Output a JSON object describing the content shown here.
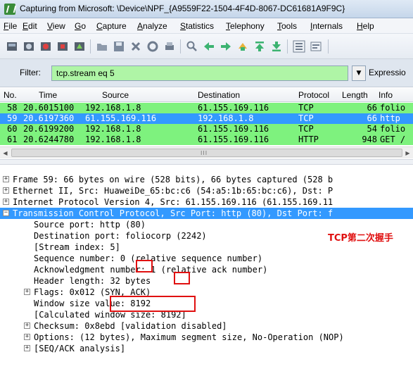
{
  "window": {
    "title": "Capturing from Microsoft: \\Device\\NPF_{A9559F22-1504-4F4D-8067-DC61681A9F9C}"
  },
  "menu": [
    "File",
    "Edit",
    "View",
    "Go",
    "Capture",
    "Analyze",
    "Statistics",
    "Telephony",
    "Tools",
    "Internals",
    "Help"
  ],
  "toolbar_icons": [
    "start-capture-icon",
    "stop-capture-icon",
    "restart-capture-icon",
    "capture-options-icon",
    "interfaces-icon",
    "open-file-icon",
    "save-file-icon",
    "close-file-icon",
    "reload-icon",
    "print-icon",
    "find-icon",
    "back-icon",
    "forward-icon",
    "goto-icon",
    "goto-first-icon",
    "goto-last-icon",
    "colorize-icon",
    "autoscroll-icon"
  ],
  "filter": {
    "label": "Filter:",
    "value": "tcp.stream eq 5",
    "expression_label": "Expressio"
  },
  "packet_list": {
    "columns": [
      "No.",
      "Time",
      "Source",
      "Destination",
      "Protocol",
      "Length",
      "Info"
    ],
    "rows": [
      {
        "no": "58",
        "time": "20.6015100",
        "source": "192.168.1.8",
        "destination": "61.155.169.116",
        "protocol": "TCP",
        "length": "66",
        "info": "folio"
      },
      {
        "no": "59",
        "time": "20.6197360",
        "source": "61.155.169.116",
        "destination": "192.168.1.8",
        "protocol": "TCP",
        "length": "66",
        "info": "http"
      },
      {
        "no": "60",
        "time": "20.6199200",
        "source": "192.168.1.8",
        "destination": "61.155.169.116",
        "protocol": "TCP",
        "length": "54",
        "info": "folio"
      },
      {
        "no": "61",
        "time": "20.6244780",
        "source": "192.168.1.8",
        "destination": "61.155.169.116",
        "protocol": "HTTP",
        "length": "948",
        "info": "GET /"
      }
    ],
    "selected_index": 1
  },
  "details": {
    "frame": "Frame 59: 66 bytes on wire (528 bits), 66 bytes captured (528 b",
    "ethernet": "Ethernet II, Src: HuaweiDe_65:bc:c6 (54:a5:1b:65:bc:c6), Dst: P",
    "ip": "Internet Protocol Version 4, Src: 61.155.169.116 (61.155.169.11",
    "tcp": "Transmission Control Protocol, Src Port: http (80), Dst Port: f",
    "src_port": "Source port: http (80)",
    "dst_port": "Destination port: foliocorp (2242)",
    "stream_index": "[Stream index: 5]",
    "seq": "Sequence number: 0    (relative sequence number)",
    "ack": "Acknowledgment number: 1    (relative ack number)",
    "header_len": "Header length: 32 bytes",
    "flags": "Flags: 0x012 (SYN, ACK)",
    "window": "Window size value: 8192",
    "calc_window": "[Calculated window size: 8192]",
    "checksum": "Checksum: 0x8ebd [validation disabled]",
    "options": "Options: (12 bytes), Maximum segment size, No-Operation (NOP)",
    "seqack": "[SEQ/ACK analysis]"
  },
  "annotation": "TCP第二次握手",
  "colors": {
    "row_normal": "#7ef27e",
    "row_selected": "#3399ff",
    "filter_ok": "#aff5a6",
    "annotation": "#e01010"
  }
}
